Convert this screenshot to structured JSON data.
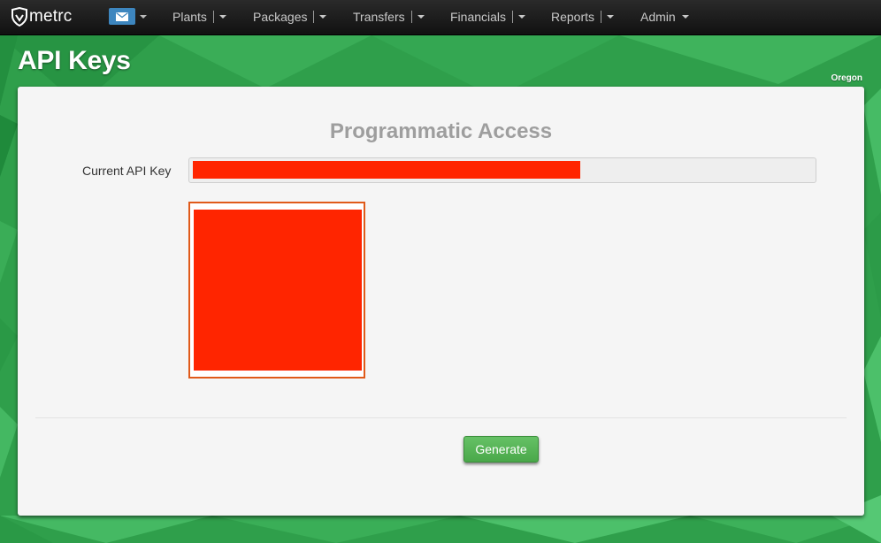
{
  "app": {
    "logo_text": "metrc"
  },
  "nav": {
    "items": [
      {
        "label": "Plants"
      },
      {
        "label": "Packages"
      },
      {
        "label": "Transfers"
      },
      {
        "label": "Financials"
      },
      {
        "label": "Reports"
      },
      {
        "label": "Admin"
      }
    ],
    "mail_icon": "envelope-icon"
  },
  "page": {
    "title": "API Keys",
    "state": "Oregon"
  },
  "panel": {
    "heading": "Programmatic Access",
    "current_key_label": "Current API Key",
    "generate_label": "Generate"
  },
  "colors": {
    "nav_bg": "#1a1a1a",
    "background_green": "#2e9e4a",
    "mail_button": "#3d86bf",
    "redaction": "#ff2500",
    "qr_border": "#e05a1a",
    "button_green": "#56b356"
  }
}
